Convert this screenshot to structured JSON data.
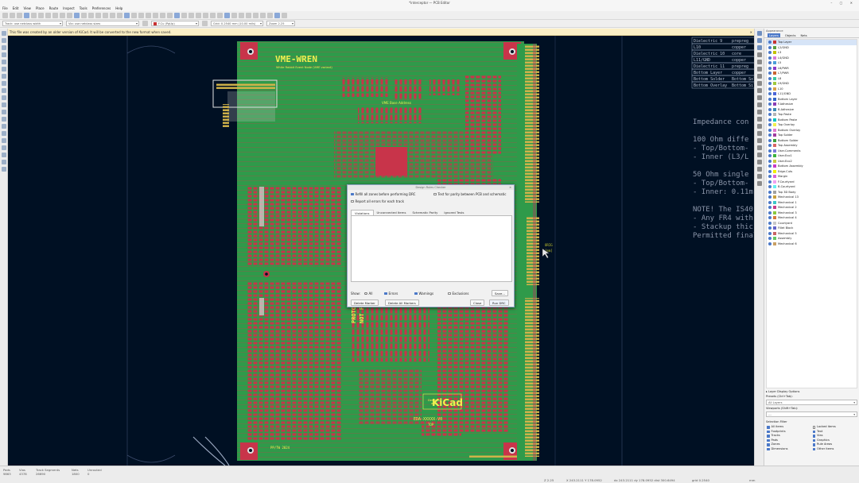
{
  "window": {
    "title": "*interceptor — PCB Editor"
  },
  "menu": [
    "File",
    "Edit",
    "View",
    "Place",
    "Route",
    "Inspect",
    "Tools",
    "Preferences",
    "Help"
  ],
  "toolbar2": {
    "track_width": "Track: use netclass width",
    "via_size": "Via: use netclass sizes",
    "layer": "F.Cu (PgUp)",
    "grid": "Grid: 0.2540 mm (10.00 mils)",
    "zoom": "Zoom 2.25"
  },
  "infobar": {
    "message": "This file was created by an older version of KiCad. It will be converted to the new format when saved."
  },
  "board": {
    "title": "VME-WREN",
    "subtitle": "White Rabbit Event Node (VME variant)",
    "section_label": "VME Base Address",
    "prototype_text": "PROTOTYPE ONLY\nNOT FOR PRODUCTION",
    "designed_label": "Designed\nwith",
    "kicad_logo": "KiCad",
    "board_id": "EDA-XXXXX-V0",
    "board_side": "TOP",
    "date": "PP/TW 2024",
    "origin_label": "ORIG",
    "origin_unit": "[mm]"
  },
  "stackup_table": [
    [
      "Dielectric 9",
      "prepreg"
    ],
    [
      "L10",
      "copper"
    ],
    [
      "Dielectric 10",
      "core"
    ],
    [
      "L11/GND",
      "copper"
    ],
    [
      "Dielectric 11",
      "prepreg"
    ],
    [
      "Bottom Layer",
      "copper"
    ],
    [
      "Bottom Solder",
      "Bottom Solder"
    ],
    [
      "Bottom Overlay",
      "Bottom Silk"
    ]
  ],
  "notes": [
    "Impedance con",
    "",
    "100 Ohm diffe",
    "- Top/Bottom-",
    "- Inner (L3/L",
    "",
    "50 Ohm single",
    "- Top/Bottom-",
    "- Inner: 0.11m",
    "",
    "NOTE! The IS40",
    "- Any FR4 with",
    "- Stackup thic",
    "Permitted final"
  ],
  "drc": {
    "title": "Design Rules Checker",
    "opt_refill": "Refill all zones before performing DRC",
    "opt_parity": "Test for parity between PCB and schematic",
    "opt_report": "Report all errors for each track",
    "tabs": [
      "Violations",
      "Unconnected Items",
      "Schematic Parity",
      "Ignored Tests"
    ],
    "show_label": "Show:",
    "filter_all": "All",
    "filter_errors": "Errors",
    "filter_warnings": "Warnings",
    "filter_exclusions": "Exclusions",
    "save_button": "Save...",
    "delete_marker": "Delete Marker",
    "delete_all": "Delete All Markers",
    "close_button": "Close",
    "run_button": "Run DRC"
  },
  "rightpanel": {
    "appearance": "Appearance",
    "tabs": [
      "Layers",
      "Objects",
      "Nets"
    ],
    "layers": [
      {
        "name": "Top Layer",
        "color": "#c83232"
      },
      {
        "name": "L2/GND",
        "color": "#5a9e3c"
      },
      {
        "name": "L3",
        "color": "#c2c200"
      },
      {
        "name": "L4/GND",
        "color": "#d87bd8"
      },
      {
        "name": "L5",
        "color": "#4a9ed8"
      },
      {
        "name": "L6/PWR",
        "color": "#8c3cc8"
      },
      {
        "name": "L7/PWR",
        "color": "#c86432"
      },
      {
        "name": "L8",
        "color": "#3cc8a0"
      },
      {
        "name": "L9/GND",
        "color": "#9ec83c"
      },
      {
        "name": "L10",
        "color": "#d8a04a"
      },
      {
        "name": "L11/GND",
        "color": "#4a64d8"
      },
      {
        "name": "Bottom Layer",
        "color": "#3264c8"
      },
      {
        "name": "F.Adhesive",
        "color": "#8a3cb4"
      },
      {
        "name": "B.Adhesive",
        "color": "#3c8ab4"
      },
      {
        "name": "Top Paste",
        "color": "#b4b4b4"
      },
      {
        "name": "Bottom Paste",
        "color": "#00c2c2"
      },
      {
        "name": "Top Overlay",
        "color": "#f0f04a"
      },
      {
        "name": "Bottom Overlay",
        "color": "#e07ad0"
      },
      {
        "name": "Top Solder",
        "color": "#a03ca0"
      },
      {
        "name": "Bottom Solder",
        "color": "#3ca03c"
      },
      {
        "name": "Top Assembly",
        "color": "#d86464"
      },
      {
        "name": "User.Comments",
        "color": "#7a7ad8"
      },
      {
        "name": "User.Eco1",
        "color": "#3cb43c"
      },
      {
        "name": "User.Eco2",
        "color": "#c8c83c"
      },
      {
        "name": "Bottom Assembly",
        "color": "#c83cc8"
      },
      {
        "name": "Edge.Cuts",
        "color": "#f0f000"
      },
      {
        "name": "Margin",
        "color": "#d864d8"
      },
      {
        "name": "F.Courtyard",
        "color": "#f0a0f0"
      },
      {
        "name": "B.Courtyard",
        "color": "#64f0f0"
      },
      {
        "name": "Top 3D Body",
        "color": "#a0a0a0"
      },
      {
        "name": "Mechanical 13",
        "color": "#c8a03c"
      },
      {
        "name": "Mechanical 1",
        "color": "#3cc8c8"
      },
      {
        "name": "Mechanical 2",
        "color": "#c83c8a"
      },
      {
        "name": "Mechanical 3",
        "color": "#8ac83c"
      },
      {
        "name": "Mechanical 4",
        "color": "#d87a3c"
      },
      {
        "name": "Courtyard",
        "color": "#c8c8c8"
      },
      {
        "name": "Fillet Block",
        "color": "#6464c8"
      },
      {
        "name": "Mechanical 5",
        "color": "#c86464"
      },
      {
        "name": "Assembly",
        "color": "#64c864"
      },
      {
        "name": "Mechanical 6",
        "color": "#c8a064"
      }
    ],
    "layer_display": "Layer Display Options",
    "presets_label": "Presets (Ctrl+Tab):",
    "presets_value": "All Layers",
    "viewports_label": "Viewports (Shift+Tab):",
    "viewports_value": "---",
    "selection_filter": "Selection Filter",
    "filters": [
      [
        "All items",
        true
      ],
      [
        "Locked items",
        false
      ],
      [
        "Footprints",
        true
      ],
      [
        "Text",
        true
      ],
      [
        "Tracks",
        true
      ],
      [
        "Vias",
        true
      ],
      [
        "Pads",
        true
      ],
      [
        "Graphics",
        true
      ],
      [
        "Zones",
        true
      ],
      [
        "Rule Areas",
        true
      ],
      [
        "Dimensions",
        true
      ],
      [
        "Other items",
        true
      ]
    ]
  },
  "status": {
    "cols": [
      [
        "Pads",
        "9863"
      ],
      [
        "Vias",
        "4378"
      ],
      [
        "Track Segments",
        "26690"
      ],
      [
        "Nets",
        "1800"
      ],
      [
        "Unrouted",
        "0"
      ]
    ],
    "zoom": "Z 2.25",
    "xy": "X 243.2111  Y 178.0952",
    "dxy": "dx 243.2111  dy 178.0952  dist 300.6494",
    "grid": "grid 0.2540",
    "unit": "mm"
  }
}
